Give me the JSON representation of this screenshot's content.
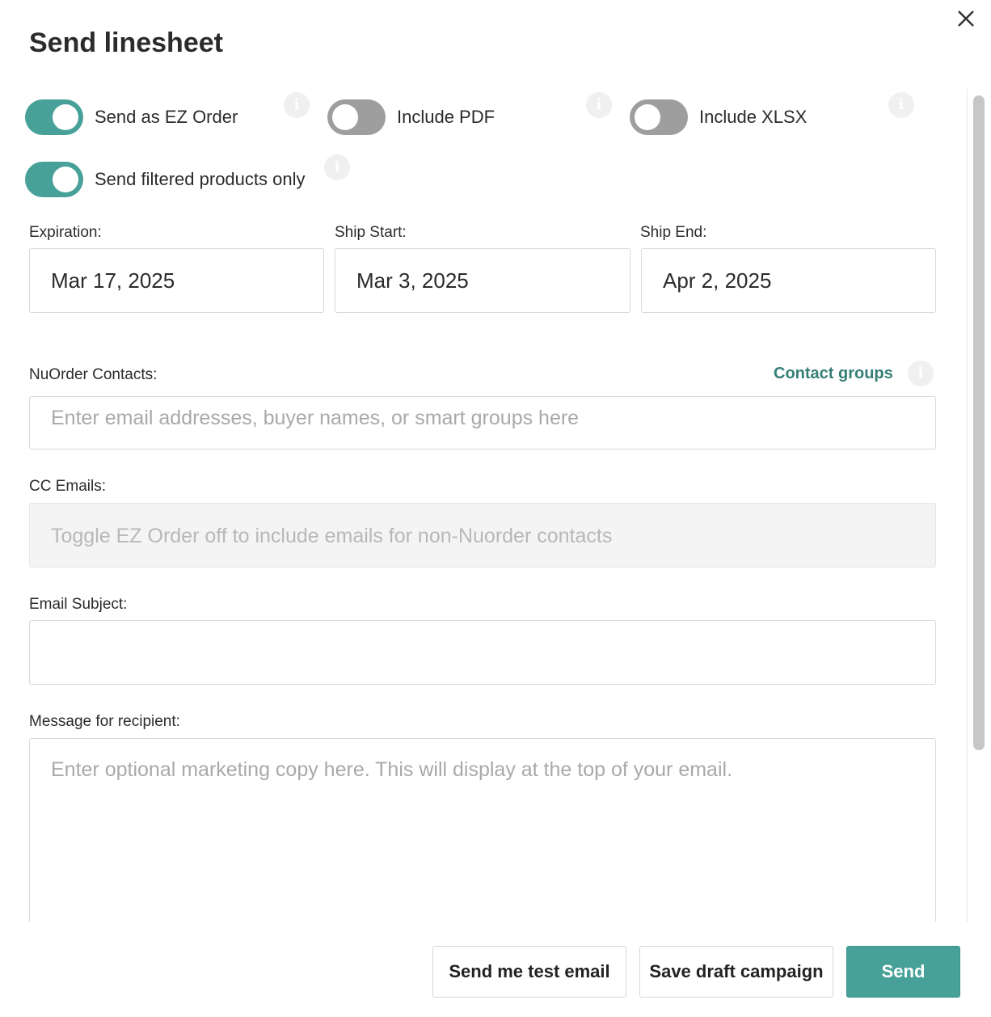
{
  "modal": {
    "title": "Send linesheet",
    "close_icon": "close-icon"
  },
  "toggles": {
    "ez_order": {
      "label": "Send as EZ Order",
      "on": true
    },
    "include_pdf": {
      "label": "Include PDF",
      "on": false
    },
    "include_xlsx": {
      "label": "Include XLSX",
      "on": false
    },
    "filtered_only": {
      "label": "Send filtered products only",
      "on": true
    }
  },
  "dates": {
    "expiration": {
      "label": "Expiration:",
      "value": "Mar 17, 2025"
    },
    "ship_start": {
      "label": "Ship Start:",
      "value": "Mar 3, 2025"
    },
    "ship_end": {
      "label": "Ship End:",
      "value": "Apr 2, 2025"
    }
  },
  "contacts": {
    "label": "NuOrder Contacts:",
    "link": "Contact groups",
    "placeholder": "Enter email addresses, buyer names, or smart groups here"
  },
  "cc": {
    "label": "CC Emails:",
    "placeholder": "Toggle EZ Order off to include emails for non-Nuorder contacts"
  },
  "subject": {
    "label": "Email Subject:",
    "value": ""
  },
  "message": {
    "label": "Message for recipient:",
    "placeholder": "Enter optional marketing copy here. This will display at the top of your email."
  },
  "info_icon": "i",
  "footer": {
    "test_email": "Send me test email",
    "save_draft": "Save draft campaign",
    "send": "Send"
  },
  "colors": {
    "accent": "#47a199",
    "link": "#367f76",
    "toggle_off": "#9e9e9e"
  }
}
